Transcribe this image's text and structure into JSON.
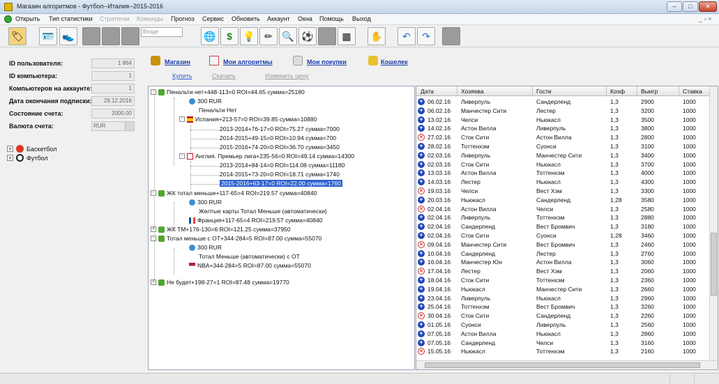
{
  "window": {
    "title": "Магазин алгоритмов - Футбол--Италия--2015-2016",
    "controls": [
      "–",
      "□",
      "✕"
    ]
  },
  "menu": [
    {
      "label": "Открыть",
      "disabled": false
    },
    {
      "label": "Тип статистики",
      "disabled": false
    },
    {
      "label": "Стратегии",
      "disabled": true
    },
    {
      "label": "Команды",
      "disabled": true
    },
    {
      "label": "Прогноз",
      "disabled": false
    },
    {
      "label": "Сервис",
      "disabled": false
    },
    {
      "label": "Обновить",
      "disabled": false
    },
    {
      "label": "Аккаунт",
      "disabled": false
    },
    {
      "label": "Окна",
      "disabled": false
    },
    {
      "label": "Помощь",
      "disabled": false
    },
    {
      "label": "Выход",
      "disabled": false
    }
  ],
  "menu_right": "_ ▫ ×",
  "toolbar": {
    "search_placeholder": "Везде",
    "icons": [
      "tag-icon",
      "id-card-icon",
      "shoe-icon",
      "blank",
      "blank",
      "blank",
      "globe-icon",
      "dollar-icon",
      "lightbulb-icon",
      "pencil-icon",
      "magnifier-icon",
      "soccer-ball-icon",
      "calculator-icon",
      "hand-icon",
      "undo-icon",
      "redo-icon",
      "blank"
    ]
  },
  "account": {
    "fields": [
      {
        "label": "ID пользователя:",
        "value": "1 864"
      },
      {
        "label": "ID компьютера:",
        "value": "1"
      },
      {
        "label": "Компьютеров на аккаунте:",
        "value": "1"
      },
      {
        "label": "Дата окончания подписки:",
        "value": "29.12.2016"
      },
      {
        "label": "Состояние счета:",
        "value": "2000.00"
      },
      {
        "label": "Валюта счета:",
        "value": "RUR"
      }
    ]
  },
  "sports": [
    {
      "label": "Баскетбол",
      "color": "#d83a1e"
    },
    {
      "label": "Футбол",
      "color": "#222222"
    }
  ],
  "nav": {
    "links": [
      {
        "label": "Магазин",
        "icon": "bag-icon"
      },
      {
        "label": "Мои алгоритмы",
        "icon": "house-icon"
      },
      {
        "label": "Мои покупки",
        "icon": "printer-icon"
      },
      {
        "label": "Кошелек",
        "icon": "folder-icon"
      }
    ],
    "actions": [
      {
        "label": "Купить",
        "disabled": false
      },
      {
        "label": "Скачать",
        "disabled": true
      },
      {
        "label": "Изменить цену",
        "disabled": true
      }
    ]
  },
  "tree": [
    {
      "text": "Пенальти нет+448-113=0 ROI=44.65 сумма=25180",
      "level": 0,
      "icon": "tag",
      "expander": "-"
    },
    {
      "text": "300 RUR",
      "level": 1,
      "icon": "globe"
    },
    {
      "text": "Пенальти Нет",
      "level": 1,
      "icon": ""
    },
    {
      "text": "Испания+213-57=0 ROI=39.85 сумма=10880",
      "level": 1,
      "icon": "flag-es",
      "expander": "-"
    },
    {
      "text": "2013-2014+76-17=0 ROI=75.27 сумма=7000",
      "level": 2,
      "icon": ""
    },
    {
      "text": "2014-2015+49-15=0 ROI=10.94 сумма=700",
      "level": 2,
      "icon": ""
    },
    {
      "text": "2015-2016+74-20=0 ROI=36.70 сумма=3450",
      "level": 2,
      "icon": ""
    },
    {
      "text": "Англия. Премьер лига+235-56=0 ROI=49.14 сумма=14300",
      "level": 1,
      "icon": "flag-gb",
      "expander": "-"
    },
    {
      "text": "2013-2014+84-14=0 ROI=114.08 сумма=11180",
      "level": 2,
      "icon": ""
    },
    {
      "text": "2014-2015+73-20=0 ROI=18.71 сумма=1740",
      "level": 2,
      "icon": ""
    },
    {
      "text": "2015-2016+63-17=0 ROI=22.00 сумма=1760",
      "level": 2,
      "icon": "",
      "selected": true
    },
    {
      "text": "ЖК тотал меньше+117-65=4 ROI=219.57 сумма=40840",
      "level": 0,
      "icon": "tag",
      "expander": "-"
    },
    {
      "text": "300 RUR",
      "level": 1,
      "icon": "globe"
    },
    {
      "text": "Желтые карты Тотал Меньше  (автоматически)",
      "level": 1,
      "icon": ""
    },
    {
      "text": "Франция+117-65=4 ROI=219.57 сумма=40840",
      "level": 1,
      "icon": "flag-fr"
    },
    {
      "text": "ЖК ТМ+176-130=6 ROI=121.25 сумма=37950",
      "level": 0,
      "icon": "tag",
      "expander": "+"
    },
    {
      "text": "Тотал меньше с ОТ+344-284=5 ROI=87.00 сумма=55070",
      "level": 0,
      "icon": "tag",
      "expander": "-"
    },
    {
      "text": "300 RUR",
      "level": 1,
      "icon": "globe"
    },
    {
      "text": "Тотал Меньше  (автоматически) с ОТ",
      "level": 1,
      "icon": ""
    },
    {
      "text": "NBA+344-284=5 ROI=87.00 сумма=55070",
      "level": 1,
      "icon": "flag-us"
    },
    {
      "text": "Не будет+198-27=1 ROI=87.48 сумма=19770",
      "level": 0,
      "icon": "tag",
      "expander": "+"
    }
  ],
  "grid": {
    "columns": [
      "Дата",
      "Хозяева",
      "Гости",
      "Коэф",
      "Выигр",
      "Ставка"
    ],
    "rows": [
      [
        "+",
        "06.02.16",
        "Ливерпуль",
        "Сандерленд",
        "1,3",
        "2900",
        "1000"
      ],
      [
        "+",
        "06.02.16",
        "Манчестер Сити",
        "Лестер",
        "1,3",
        "3200",
        "1000"
      ],
      [
        "+",
        "13.02.16",
        "Челси",
        "Ньюкасл",
        "1,3",
        "3500",
        "1000"
      ],
      [
        "+",
        "14.02.16",
        "Астон Вилла",
        "Ливерпуль",
        "1,3",
        "3800",
        "1000"
      ],
      [
        "-",
        "27.02.16",
        "Сток Сити",
        "Астон Вилла",
        "1,3",
        "2800",
        "1000"
      ],
      [
        "+",
        "28.02.16",
        "Тоттенхэм",
        "Суонси",
        "1,3",
        "3100",
        "1000"
      ],
      [
        "+",
        "02.03.16",
        "Ливерпуль",
        "Манчестер Сити",
        "1,3",
        "3400",
        "1000"
      ],
      [
        "+",
        "02.03.16",
        "Сток Сити",
        "Ньюкасл",
        "1,3",
        "3700",
        "1000"
      ],
      [
        "+",
        "13.03.16",
        "Астон Вилла",
        "Тоттенхэм",
        "1,3",
        "4000",
        "1000"
      ],
      [
        "+",
        "14.03.16",
        "Лестер",
        "Ньюкасл",
        "1,3",
        "4300",
        "1000"
      ],
      [
        "-",
        "19.03.16",
        "Челси",
        "Вест Хэм",
        "1,3",
        "3300",
        "1000"
      ],
      [
        "+",
        "20.03.16",
        "Ньюкасл",
        "Сандерленд",
        "1,28",
        "3580",
        "1000"
      ],
      [
        "-",
        "02.04.16",
        "Астон Вилла",
        "Челси",
        "1,3",
        "2580",
        "1000"
      ],
      [
        "+",
        "02.04.16",
        "Ливерпуль",
        "Тоттенхэм",
        "1,3",
        "2880",
        "1000"
      ],
      [
        "+",
        "02.04.16",
        "Сандерленд",
        "Вест Бромвич",
        "1,3",
        "3180",
        "1000"
      ],
      [
        "+",
        "02.04.16",
        "Сток Сити",
        "Суонси",
        "1,28",
        "3460",
        "1000"
      ],
      [
        "-",
        "09.04.16",
        "Манчестер Сити",
        "Вест Бромвич",
        "1,3",
        "2460",
        "1000"
      ],
      [
        "+",
        "10.04.16",
        "Сандерленд",
        "Лестер",
        "1,3",
        "2760",
        "1000"
      ],
      [
        "+",
        "16.04.16",
        "Манчестер Юн",
        "Астон Вилла",
        "1,3",
        "3060",
        "1000"
      ],
      [
        "-",
        "17.04.16",
        "Лестер",
        "Вест Хэм",
        "1,3",
        "2060",
        "1000"
      ],
      [
        "+",
        "18.04.16",
        "Сток Сити",
        "Тоттенхэм",
        "1,3",
        "2360",
        "1000"
      ],
      [
        "+",
        "19.04.16",
        "Ньюкасл",
        "Манчестер Сити",
        "1,3",
        "2660",
        "1000"
      ],
      [
        "+",
        "23.04.16",
        "Ливерпуль",
        "Ньюкасл",
        "1,3",
        "2960",
        "1000"
      ],
      [
        "+",
        "25.04.16",
        "Тоттенхэм",
        "Вест Бромвич",
        "1,3",
        "3260",
        "1000"
      ],
      [
        "-",
        "30.04.16",
        "Сток Сити",
        "Сандерленд",
        "1,3",
        "2260",
        "1000"
      ],
      [
        "+",
        "01.05.16",
        "Суонси",
        "Ливерпуль",
        "1,3",
        "2560",
        "1000"
      ],
      [
        "+",
        "07.05.16",
        "Астон Вилла",
        "Ньюкасл",
        "1,3",
        "2860",
        "1000"
      ],
      [
        "+",
        "07.05.16",
        "Сандерленд",
        "Челси",
        "1,3",
        "3160",
        "1000"
      ],
      [
        "-",
        "15.05.16",
        "Ньюкасл",
        "Тоттенхэм",
        "1,3",
        "2160",
        "1000"
      ]
    ]
  },
  "colors": {
    "selection": "#2f62d0",
    "win": "#2244b8",
    "loss": "#d22c2c",
    "link": "#1a3fb0"
  }
}
